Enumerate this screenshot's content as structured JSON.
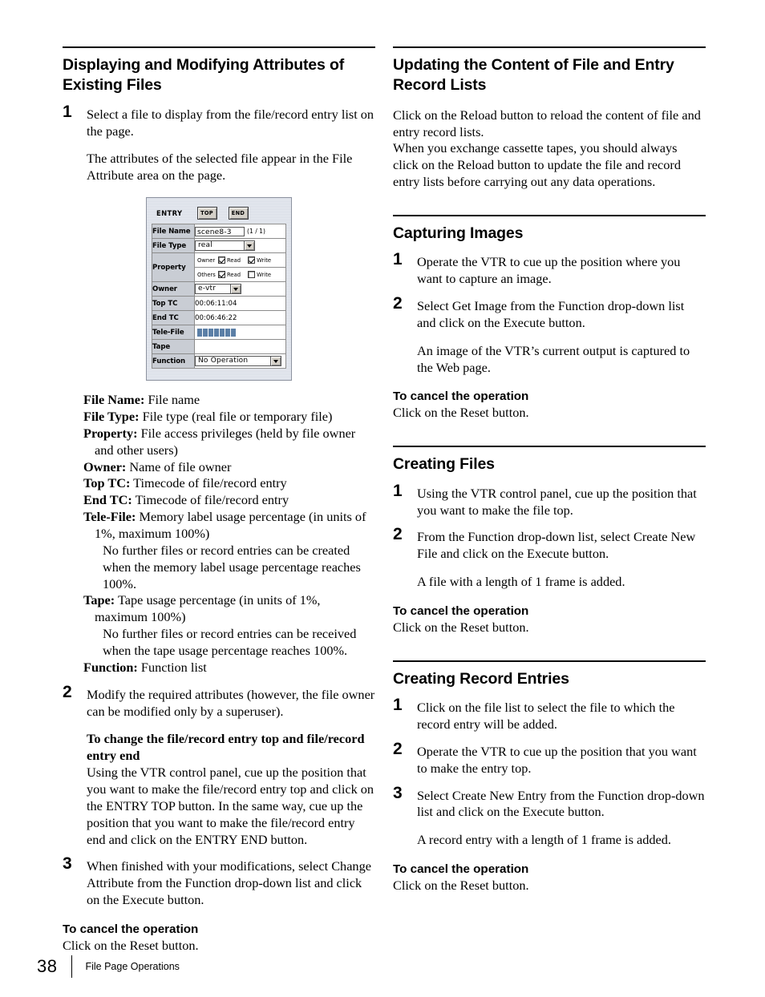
{
  "left_column": {
    "section1": {
      "heading": "Displaying and Modifying Attributes of Existing Files",
      "step1_num": "1",
      "step1_text": "Select a file to display from the file/record entry list on the page.",
      "step1_note": "The attributes of the selected file appear in the File Attribute area on the page.",
      "step2_num": "2",
      "step2_text": "Modify the required attributes (however, the file owner can be modified only by a superuser).",
      "step2_subhead": "To change the file/record entry top and file/record entry end",
      "step2_sub_text": "Using the VTR control panel, cue up the position that you want to make the file/record entry top and click on the ENTRY TOP button. In the same way, cue up the position that you want to make the file/record entry end and click on the ENTRY END button.",
      "step3_num": "3",
      "step3_text": "When finished with your modifications, select Change Attribute from the Function drop-down list and click on the Execute button.",
      "cancel_head": "To cancel the operation",
      "cancel_text": "Click on the Reset button."
    },
    "definitions": [
      {
        "term": "File Name:",
        "desc": " File name",
        "cont": []
      },
      {
        "term": "File Type:",
        "desc": " File type (real file or temporary file)",
        "cont": []
      },
      {
        "term": "Property:",
        "desc": " File access privileges (held by file owner and other users)",
        "cont": []
      },
      {
        "term": "Owner:",
        "desc": " Name of file owner",
        "cont": []
      },
      {
        "term": "Top TC:",
        "desc": " Timecode of file/record entry",
        "cont": []
      },
      {
        "term": "End TC:",
        "desc": " Timecode of file/record entry",
        "cont": []
      },
      {
        "term": "Tele-File:",
        "desc": " Memory label usage percentage (in units of 1%, maximum 100%)",
        "cont": [
          "No further files or record entries can be created when the memory label usage percentage reaches 100%."
        ]
      },
      {
        "term": "Tape:",
        "desc": " Tape usage percentage (in units of 1%, maximum 100%)",
        "cont": [
          "No further files or record entries can be received when the tape usage percentage reaches 100%."
        ]
      },
      {
        "term": "Function:",
        "desc": " Function list",
        "cont": []
      }
    ]
  },
  "figure": {
    "name": "file-attribute-panel",
    "entry_label": "ENTRY",
    "top_button": "TOP",
    "end_button": "END",
    "rows": {
      "file_name_label": "File Name",
      "file_name_value": "scene8-3",
      "page_count": "(1 / 1)",
      "file_type_label": "File Type",
      "file_type_value": "real",
      "property_label": "Property",
      "property_owner_label": "Owner",
      "property_others_label": "Others",
      "read_label": "Read",
      "write_label": "Write",
      "owner_read_checked": true,
      "owner_write_checked": true,
      "others_read_checked": true,
      "others_write_checked": false,
      "owner_label": "Owner",
      "owner_value": "e-vtr",
      "top_tc_label": "Top TC",
      "top_tc_value": "00:06:11:04",
      "end_tc_label": "End TC",
      "end_tc_value": "00:06:46:22",
      "tele_file_label": "Tele-File",
      "tele_file_segments": 7,
      "tele_file_color": "#5b7fa6",
      "tape_label": "Tape",
      "tape_value": "",
      "function_label": "Function",
      "function_value": "No Operation"
    }
  },
  "right_column": {
    "section_update": {
      "heading": "Updating the Content of File and Entry Record Lists",
      "para1": "Click on the Reload button to reload the content of file and entry record lists.",
      "para2": "When you exchange cassette tapes, you should always click on the Reload button to update the file and record entry lists before carrying out any data operations."
    },
    "section_capture": {
      "heading": "Capturing Images",
      "step1_num": "1",
      "step1_text": "Operate the VTR to cue up the position where you want to capture an image.",
      "step2_num": "2",
      "step2_text": "Select Get Image from the Function drop-down list and click on the Execute button.",
      "step2_note": "An image of the VTR’s current output is captured to the Web page.",
      "cancel_head": "To cancel the operation",
      "cancel_text": "Click on the Reset button."
    },
    "section_creating_files": {
      "heading": "Creating Files",
      "step1_num": "1",
      "step1_text": "Using the VTR control panel, cue up the position that you want to make the file top.",
      "step2_num": "2",
      "step2_text": "From the Function drop-down list, select Create New File and click on the Execute button.",
      "step2_note": "A file with a length of 1 frame is added.",
      "cancel_head": "To cancel the operation",
      "cancel_text": "Click on the Reset button."
    },
    "section_creating_entries": {
      "heading": "Creating Record Entries",
      "step1_num": "1",
      "step1_text": "Click on the file list to select the file to which the record entry will be added.",
      "step2_num": "2",
      "step2_text": "Operate the VTR to cue up the position that you want to make the entry top.",
      "step3_num": "3",
      "step3_text": "Select Create New Entry from the Function drop-down list and click on the Execute button.",
      "step3_note": "A record entry with a length of 1 frame is added.",
      "cancel_head": "To cancel the operation",
      "cancel_text": "Click on the Reset button."
    }
  },
  "footer": {
    "page_number": "38",
    "running_title": "File Page Operations"
  }
}
